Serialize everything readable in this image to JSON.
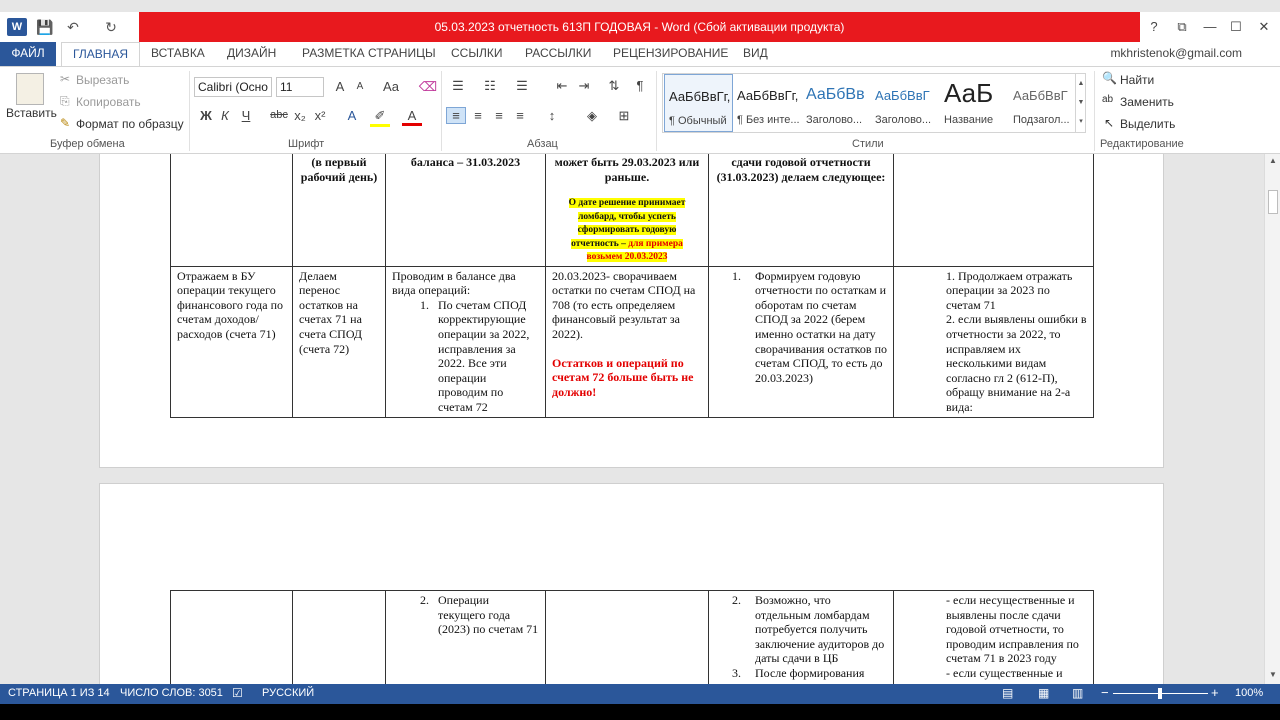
{
  "window": {
    "title": "05.03.2023 отчетность 613П ГОДОВАЯ -  Word (Сбой активации продукта)",
    "help": "?",
    "min": "—",
    "max": "☐",
    "close": "✕",
    "restore": "⧉"
  },
  "quick_access": {
    "save_icon": "save-icon",
    "undo_icon": "undo-icon",
    "redo_icon": "redo-icon"
  },
  "tabs": {
    "file": "ФАЙЛ",
    "items": [
      "ГЛАВНАЯ",
      "ВСТАВКА",
      "ДИЗАЙН",
      "РАЗМЕТКА СТРАНИЦЫ",
      "ССЫЛКИ",
      "РАССЫЛКИ",
      "РЕЦЕНЗИРОВАНИЕ",
      "ВИД"
    ],
    "account": "mkhristenok@gmail.com"
  },
  "ribbon": {
    "clipboard": {
      "paste": "Вставить",
      "cut": "Вырезать",
      "copy": "Копировать",
      "format_painter": "Формат по образцу",
      "label": "Буфер обмена"
    },
    "font": {
      "name": "Calibri (Осно",
      "size": "11",
      "label": "Шрифт",
      "bold": "Ж",
      "italic": "К",
      "underline": "Ч",
      "strike": "abc",
      "sub": "x₂",
      "sup": "x²",
      "case": "Аа",
      "grow": "A",
      "shrink": "A"
    },
    "paragraph": {
      "label": "Абзац"
    },
    "styles": {
      "label": "Стили",
      "items": [
        {
          "sample": "АаБбВвГг,",
          "name": "¶ Обычный"
        },
        {
          "sample": "АаБбВвГг,",
          "name": "¶ Без инте..."
        },
        {
          "sample": "АаБбВв",
          "name": "Заголово..."
        },
        {
          "sample": "АаБбВвГ",
          "name": "Заголово..."
        },
        {
          "sample": "АаБ",
          "name": "Название"
        },
        {
          "sample": "АаБбВвГ",
          "name": "Подзагол..."
        }
      ]
    },
    "editing": {
      "find": "Найти",
      "replace": "Заменить",
      "select": "Выделить",
      "label": "Редактирование"
    }
  },
  "doc": {
    "header_row": {
      "c2": "(в первый рабочий день)",
      "c3": "баланса – 31.03.2023",
      "c4_main": "может быть 29.03.2023 или раньше.",
      "c4_note_a": "О дате решение принимает ломбард, чтобы успеть сформировать годовую отчетность – ",
      "c4_note_b": "для примера возьмем 20.03.2023",
      "c5": "сдачи годовой отчетности (31.03.2023) делаем следующее:"
    },
    "row1": {
      "c1": "Отражаем в БУ операции текущего финансового года по счетам доходов/расходов (счета 71)",
      "c2": "Делаем перенос остатков на счетах 71 на счета СПОД (счета 72)",
      "c3_intro": "Проводим в балансе два вида операций:",
      "c3_n": "1.",
      "c3_item": "По счетам СПОД корректирующие операции за 2022, исправления за 2022. Все эти операции проводим по счетам 72",
      "c4_text": "20.03.2023- сворачиваем остатки по счетам СПОД на 708 (то есть определяем финансовый результат за 2022).",
      "c4_red": "Остатков и операций по счетам 72 больше быть не должно!",
      "c5_n": "1.",
      "c5_item": "Формируем годовую отчетности по остаткам и оборотам по счетам СПОД за 2022 (берем именно остатки на дату сворачивания остатков по счетам СПОД, то есть до 20.03.2023)",
      "c6_1": "1. Продолжаем отражать операции за 2023 по счетам 71",
      "c6_2": "2. если выявлены ошибки в отчетности за 2022, то исправляем их несколькими видам согласно гл 2 (612-П), обращу внимание на 2-а вида:"
    },
    "row2": {
      "c3_n": "2.",
      "c3_item": "Операции текущего года (2023) по счетам 71",
      "c5_n2": "2.",
      "c5_item2": "Возможно, что отдельным ломбардам потребуется получить заключение аудиторов до даты сдачи в ЦБ",
      "c5_n3": "3.",
      "c5_item3": "После формирования",
      "c6_a": "- если несущественные и выявлены после сдачи годовой отчетности, то проводим исправления по счетам 71 в 2023 году",
      "c6_b": "- если существенные и"
    }
  },
  "status": {
    "page": "СТРАНИЦА 1 ИЗ 14",
    "words": "ЧИСЛО СЛОВ: 3051",
    "lang": "РУССКИЙ",
    "zoom": "100%",
    "zoom_level": 100
  }
}
